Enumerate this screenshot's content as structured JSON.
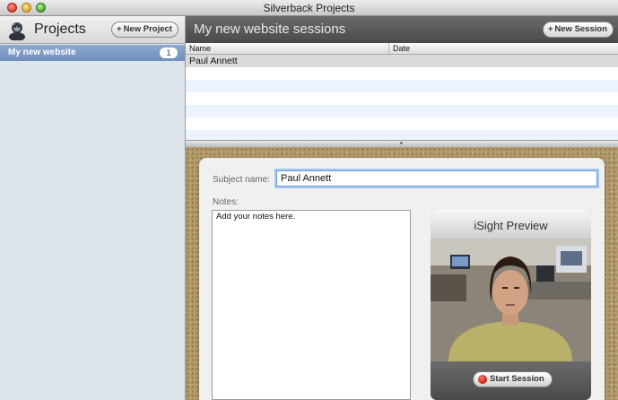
{
  "window": {
    "title": "Silverback Projects"
  },
  "sidebar": {
    "title": "Projects",
    "new_project_label": "New Project",
    "projects": [
      {
        "name": "My new website",
        "count": "1"
      }
    ]
  },
  "main": {
    "title": "My new website sessions",
    "new_session_label": "New Session",
    "table": {
      "columns": [
        "Name",
        "Date"
      ],
      "rows": [
        {
          "name": "Paul Annett",
          "date": ""
        }
      ]
    }
  },
  "detail": {
    "subject_label": "Subject name:",
    "subject_value": "Paul Annett",
    "notes_label": "Notes:",
    "notes_value": "Add your notes here.",
    "isight_title": "iSight Preview",
    "start_session_label": "Start Session"
  },
  "icons": {
    "app_logo": "silverback-gorilla-icon",
    "add": "plus-icon",
    "record": "record-dot-icon"
  },
  "colors": {
    "selection": "#7a96c4",
    "record": "#d11a0c",
    "field_focus": "#6a9ad3"
  }
}
